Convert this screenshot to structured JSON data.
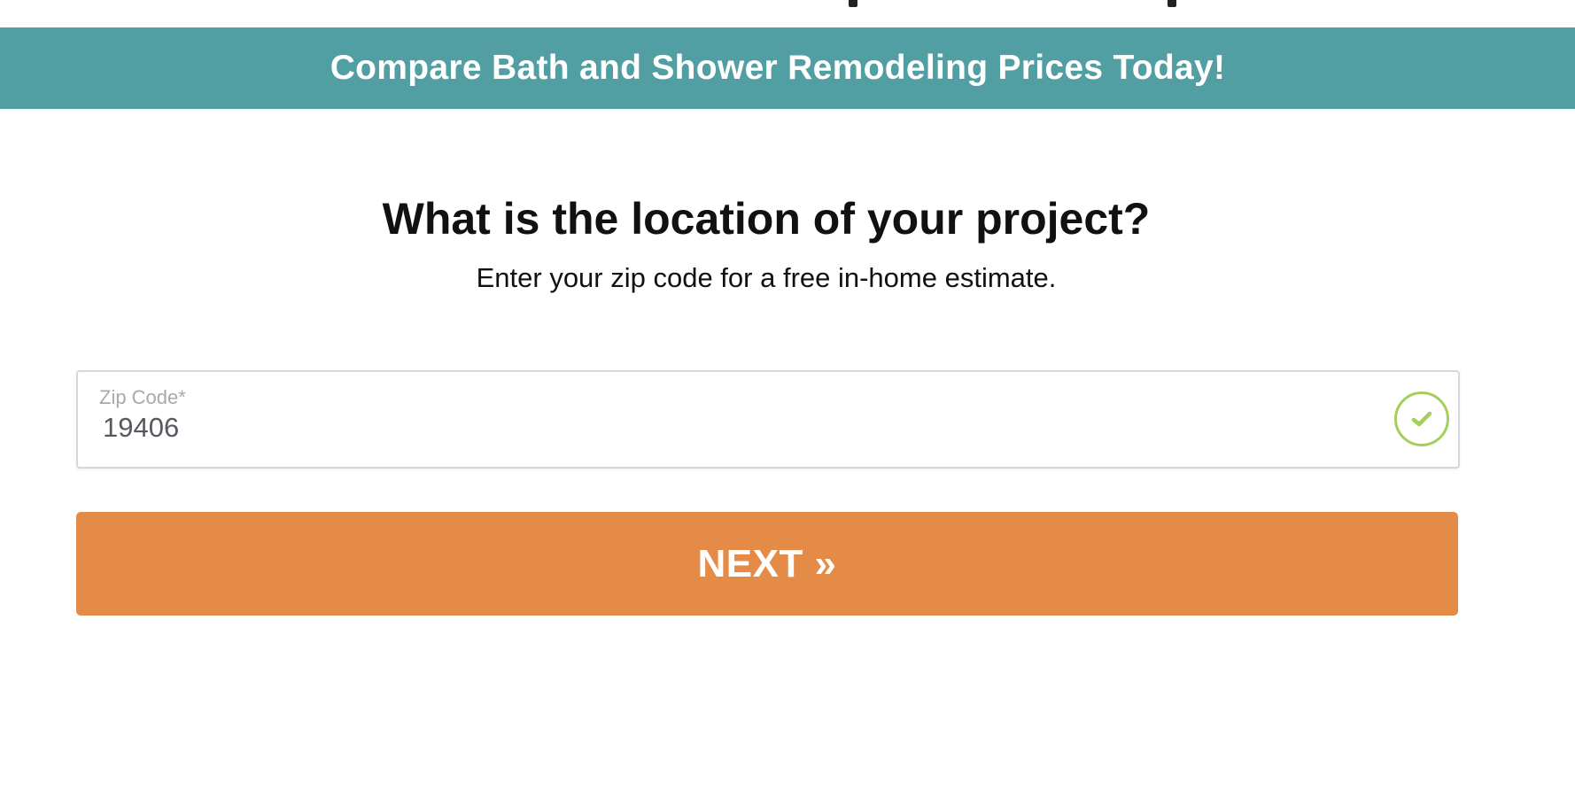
{
  "banner": {
    "text": "Compare Bath and Shower Remodeling Prices Today!",
    "background_color": "#519fa3"
  },
  "main": {
    "question": "What is the location of your project?",
    "subtitle": "Enter your zip code for a free in-home estimate."
  },
  "zip_field": {
    "label": "Zip Code*",
    "value": "19406",
    "status_icon": "check-circle-icon",
    "status_color": "#a4cf5a"
  },
  "next_button": {
    "label": "NEXT »",
    "color": "#e58b48"
  }
}
